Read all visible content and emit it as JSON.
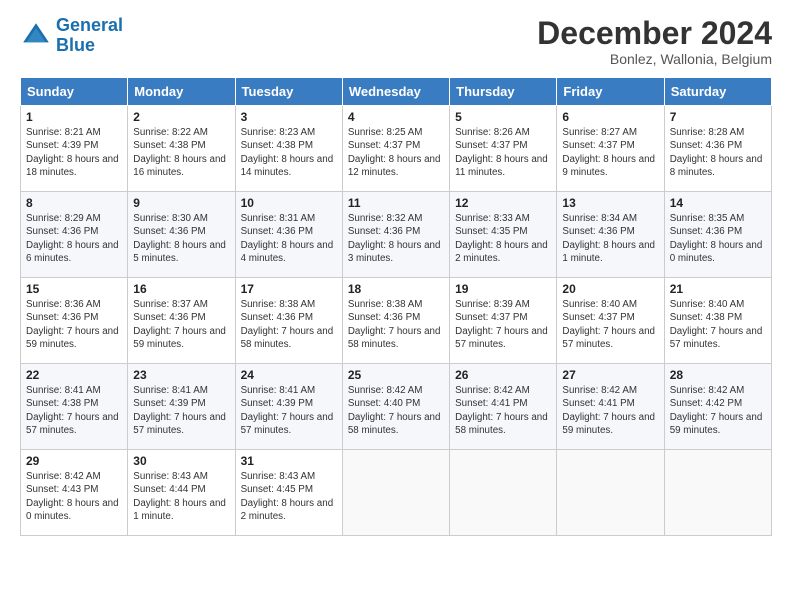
{
  "header": {
    "logo_line1": "General",
    "logo_line2": "Blue",
    "month": "December 2024",
    "location": "Bonlez, Wallonia, Belgium"
  },
  "weekdays": [
    "Sunday",
    "Monday",
    "Tuesday",
    "Wednesday",
    "Thursday",
    "Friday",
    "Saturday"
  ],
  "weeks": [
    [
      {
        "day": "1",
        "sunrise": "8:21 AM",
        "sunset": "4:39 PM",
        "daylight": "8 hours and 18 minutes."
      },
      {
        "day": "2",
        "sunrise": "8:22 AM",
        "sunset": "4:38 PM",
        "daylight": "8 hours and 16 minutes."
      },
      {
        "day": "3",
        "sunrise": "8:23 AM",
        "sunset": "4:38 PM",
        "daylight": "8 hours and 14 minutes."
      },
      {
        "day": "4",
        "sunrise": "8:25 AM",
        "sunset": "4:37 PM",
        "daylight": "8 hours and 12 minutes."
      },
      {
        "day": "5",
        "sunrise": "8:26 AM",
        "sunset": "4:37 PM",
        "daylight": "8 hours and 11 minutes."
      },
      {
        "day": "6",
        "sunrise": "8:27 AM",
        "sunset": "4:37 PM",
        "daylight": "8 hours and 9 minutes."
      },
      {
        "day": "7",
        "sunrise": "8:28 AM",
        "sunset": "4:36 PM",
        "daylight": "8 hours and 8 minutes."
      }
    ],
    [
      {
        "day": "8",
        "sunrise": "8:29 AM",
        "sunset": "4:36 PM",
        "daylight": "8 hours and 6 minutes."
      },
      {
        "day": "9",
        "sunrise": "8:30 AM",
        "sunset": "4:36 PM",
        "daylight": "8 hours and 5 minutes."
      },
      {
        "day": "10",
        "sunrise": "8:31 AM",
        "sunset": "4:36 PM",
        "daylight": "8 hours and 4 minutes."
      },
      {
        "day": "11",
        "sunrise": "8:32 AM",
        "sunset": "4:36 PM",
        "daylight": "8 hours and 3 minutes."
      },
      {
        "day": "12",
        "sunrise": "8:33 AM",
        "sunset": "4:35 PM",
        "daylight": "8 hours and 2 minutes."
      },
      {
        "day": "13",
        "sunrise": "8:34 AM",
        "sunset": "4:36 PM",
        "daylight": "8 hours and 1 minute."
      },
      {
        "day": "14",
        "sunrise": "8:35 AM",
        "sunset": "4:36 PM",
        "daylight": "8 hours and 0 minutes."
      }
    ],
    [
      {
        "day": "15",
        "sunrise": "8:36 AM",
        "sunset": "4:36 PM",
        "daylight": "7 hours and 59 minutes."
      },
      {
        "day": "16",
        "sunrise": "8:37 AM",
        "sunset": "4:36 PM",
        "daylight": "7 hours and 59 minutes."
      },
      {
        "day": "17",
        "sunrise": "8:38 AM",
        "sunset": "4:36 PM",
        "daylight": "7 hours and 58 minutes."
      },
      {
        "day": "18",
        "sunrise": "8:38 AM",
        "sunset": "4:36 PM",
        "daylight": "7 hours and 58 minutes."
      },
      {
        "day": "19",
        "sunrise": "8:39 AM",
        "sunset": "4:37 PM",
        "daylight": "7 hours and 57 minutes."
      },
      {
        "day": "20",
        "sunrise": "8:40 AM",
        "sunset": "4:37 PM",
        "daylight": "7 hours and 57 minutes."
      },
      {
        "day": "21",
        "sunrise": "8:40 AM",
        "sunset": "4:38 PM",
        "daylight": "7 hours and 57 minutes."
      }
    ],
    [
      {
        "day": "22",
        "sunrise": "8:41 AM",
        "sunset": "4:38 PM",
        "daylight": "7 hours and 57 minutes."
      },
      {
        "day": "23",
        "sunrise": "8:41 AM",
        "sunset": "4:39 PM",
        "daylight": "7 hours and 57 minutes."
      },
      {
        "day": "24",
        "sunrise": "8:41 AM",
        "sunset": "4:39 PM",
        "daylight": "7 hours and 57 minutes."
      },
      {
        "day": "25",
        "sunrise": "8:42 AM",
        "sunset": "4:40 PM",
        "daylight": "7 hours and 58 minutes."
      },
      {
        "day": "26",
        "sunrise": "8:42 AM",
        "sunset": "4:41 PM",
        "daylight": "7 hours and 58 minutes."
      },
      {
        "day": "27",
        "sunrise": "8:42 AM",
        "sunset": "4:41 PM",
        "daylight": "7 hours and 59 minutes."
      },
      {
        "day": "28",
        "sunrise": "8:42 AM",
        "sunset": "4:42 PM",
        "daylight": "7 hours and 59 minutes."
      }
    ],
    [
      {
        "day": "29",
        "sunrise": "8:42 AM",
        "sunset": "4:43 PM",
        "daylight": "8 hours and 0 minutes."
      },
      {
        "day": "30",
        "sunrise": "8:43 AM",
        "sunset": "4:44 PM",
        "daylight": "8 hours and 1 minute."
      },
      {
        "day": "31",
        "sunrise": "8:43 AM",
        "sunset": "4:45 PM",
        "daylight": "8 hours and 2 minutes."
      },
      null,
      null,
      null,
      null
    ]
  ]
}
